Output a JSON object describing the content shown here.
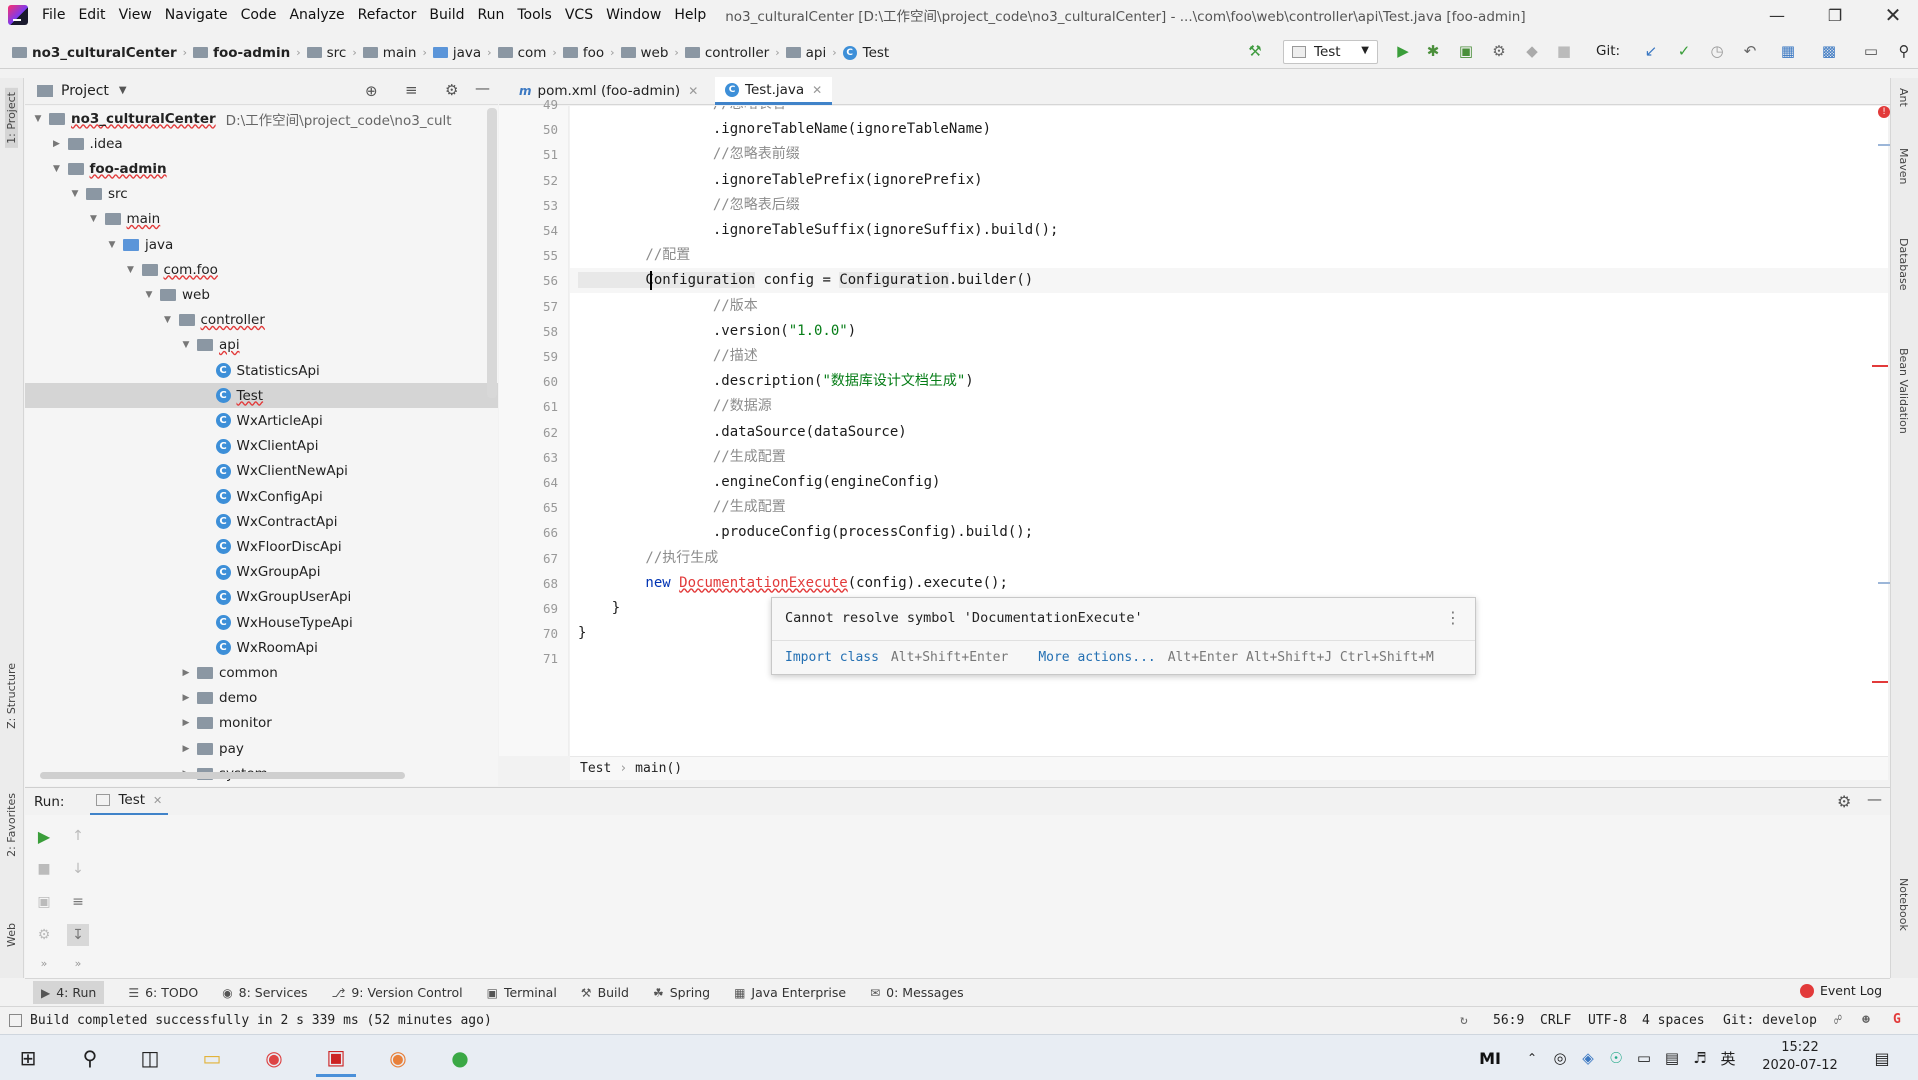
{
  "menu": {
    "items": [
      "File",
      "Edit",
      "View",
      "Navigate",
      "Code",
      "Analyze",
      "Refactor",
      "Build",
      "Run",
      "Tools",
      "VCS",
      "Window",
      "Help"
    ],
    "window_title": "no3_culturalCenter [D:\\工作空间\\project_code\\no3_culturalCenter] - ...\\com\\foo\\web\\controller\\api\\Test.java [foo-admin]"
  },
  "navbar": {
    "crumbs": [
      "no3_culturalCenter",
      "foo-admin",
      "src",
      "main",
      "java",
      "com",
      "foo",
      "web",
      "controller",
      "api",
      "Test"
    ],
    "run_config": "Test",
    "git_label": "Git:"
  },
  "project_panel": {
    "title": "Project",
    "tree": [
      {
        "label": "no3_culturalCenter",
        "path": "D:\\工作空间\\project_code\\no3_cult",
        "depth": 0,
        "type": "module",
        "open": true
      },
      {
        "label": ".idea",
        "depth": 1,
        "type": "folder",
        "open": false
      },
      {
        "label": "foo-admin",
        "depth": 1,
        "type": "module",
        "open": true
      },
      {
        "label": "src",
        "depth": 2,
        "type": "folder",
        "open": true
      },
      {
        "label": "main",
        "depth": 3,
        "type": "folder",
        "open": true
      },
      {
        "label": "java",
        "depth": 4,
        "type": "src",
        "open": true
      },
      {
        "label": "com.foo",
        "depth": 5,
        "type": "folder",
        "open": true
      },
      {
        "label": "web",
        "depth": 6,
        "type": "folder",
        "open": true
      },
      {
        "label": "controller",
        "depth": 7,
        "type": "folder",
        "open": true
      },
      {
        "label": "api",
        "depth": 8,
        "type": "folder",
        "open": true
      },
      {
        "label": "StatisticsApi",
        "depth": 9,
        "type": "class"
      },
      {
        "label": "Test",
        "depth": 9,
        "type": "class",
        "selected": true
      },
      {
        "label": "WxArticleApi",
        "depth": 9,
        "type": "class"
      },
      {
        "label": "WxClientApi",
        "depth": 9,
        "type": "class"
      },
      {
        "label": "WxClientNewApi",
        "depth": 9,
        "type": "class"
      },
      {
        "label": "WxConfigApi",
        "depth": 9,
        "type": "class"
      },
      {
        "label": "WxContractApi",
        "depth": 9,
        "type": "class"
      },
      {
        "label": "WxFloorDiscApi",
        "depth": 9,
        "type": "class"
      },
      {
        "label": "WxGroupApi",
        "depth": 9,
        "type": "class"
      },
      {
        "label": "WxGroupUserApi",
        "depth": 9,
        "type": "class"
      },
      {
        "label": "WxHouseTypeApi",
        "depth": 9,
        "type": "class"
      },
      {
        "label": "WxRoomApi",
        "depth": 9,
        "type": "class"
      },
      {
        "label": "common",
        "depth": 8,
        "type": "folder",
        "open": false
      },
      {
        "label": "demo",
        "depth": 8,
        "type": "folder",
        "open": false
      },
      {
        "label": "monitor",
        "depth": 8,
        "type": "folder",
        "open": false
      },
      {
        "label": "pay",
        "depth": 8,
        "type": "folder",
        "open": false
      },
      {
        "label": "system",
        "depth": 8,
        "type": "folder",
        "open": false
      }
    ]
  },
  "editor": {
    "tabs": [
      {
        "label": "pom.xml (foo-admin)",
        "active": false
      },
      {
        "label": "Test.java",
        "active": true
      }
    ],
    "lines": [
      {
        "n": "49",
        "tokens": [
          [
            "cmt",
            "                //忽略表名"
          ]
        ]
      },
      {
        "n": "50",
        "tokens": [
          [
            "ident",
            "                .ignoreTableName(ignoreTableName)"
          ]
        ]
      },
      {
        "n": "51",
        "tokens": [
          [
            "cmt",
            "                //忽略表前缀"
          ]
        ]
      },
      {
        "n": "52",
        "tokens": [
          [
            "ident",
            "                .ignoreTablePrefix(ignorePrefix)"
          ]
        ]
      },
      {
        "n": "53",
        "tokens": [
          [
            "cmt",
            "                //忽略表后缀"
          ]
        ]
      },
      {
        "n": "54",
        "tokens": [
          [
            "ident",
            "                .ignoreTableSuffix(ignoreSuffix).build();"
          ]
        ]
      },
      {
        "n": "55",
        "tokens": [
          [
            "cmt",
            "        //配置"
          ]
        ]
      },
      {
        "n": "56",
        "tokens": [
          [
            "typ",
            "        Configuration"
          ],
          [
            "ident",
            " config = "
          ],
          [
            "typ",
            "Configuration"
          ],
          [
            "ident",
            ".builder()"
          ]
        ],
        "caret": true
      },
      {
        "n": "57",
        "tokens": [
          [
            "cmt",
            "                //版本"
          ]
        ]
      },
      {
        "n": "58",
        "tokens": [
          [
            "ident",
            "                .version("
          ],
          [
            "str",
            "\"1.0.0\""
          ],
          [
            "ident",
            ")"
          ]
        ]
      },
      {
        "n": "59",
        "tokens": [
          [
            "cmt",
            "                //描述"
          ]
        ]
      },
      {
        "n": "60",
        "tokens": [
          [
            "ident",
            "                .description("
          ],
          [
            "str",
            "\"数据库设计文档生成\""
          ],
          [
            "ident",
            ")"
          ]
        ]
      },
      {
        "n": "61",
        "tokens": [
          [
            "cmt",
            "                //数据源"
          ]
        ]
      },
      {
        "n": "62",
        "tokens": [
          [
            "ident",
            "                .dataSource(dataSource)"
          ]
        ]
      },
      {
        "n": "63",
        "tokens": [
          [
            "cmt",
            "                //生成配置"
          ]
        ]
      },
      {
        "n": "64",
        "tokens": [
          [
            "ident",
            "                .engineConfig(engineConfig)"
          ]
        ]
      },
      {
        "n": "65",
        "tokens": [
          [
            "cmt",
            "                //生成配置"
          ]
        ]
      },
      {
        "n": "66",
        "tokens": [
          [
            "ident",
            "                .produceConfig(processConfig).build();"
          ]
        ]
      },
      {
        "n": "67",
        "tokens": [
          [
            "cmt",
            "        //执行生成"
          ]
        ]
      },
      {
        "n": "68",
        "tokens": [
          [
            "kw",
            "        new "
          ],
          [
            "err",
            "DocumentationExecute"
          ],
          [
            "ident",
            "(config).execute();"
          ]
        ]
      },
      {
        "n": "69",
        "tokens": [
          [
            "ident",
            "    }"
          ]
        ]
      },
      {
        "n": "70",
        "tokens": [
          [
            "ident",
            "}"
          ]
        ]
      },
      {
        "n": "71",
        "tokens": [
          [
            "ident",
            ""
          ]
        ]
      }
    ],
    "breadcrumb": [
      "Test",
      "main()"
    ]
  },
  "popup": {
    "message": "Cannot resolve symbol 'DocumentationExecute'",
    "action1": "Import class",
    "action1_keys": "Alt+Shift+Enter",
    "action2": "More actions...",
    "action2_keys": "Alt+Enter Alt+Shift+J Ctrl+Shift+M"
  },
  "run_panel": {
    "label": "Run:",
    "tab": "Test"
  },
  "tool_tabs": [
    {
      "label": "4: Run",
      "icon": "run-icon"
    },
    {
      "label": "6: TODO",
      "icon": "todo-icon"
    },
    {
      "label": "8: Services",
      "icon": "services-icon"
    },
    {
      "label": "9: Version Control",
      "icon": "vcs-icon"
    },
    {
      "label": "Terminal",
      "icon": "terminal-icon"
    },
    {
      "label": "Build",
      "icon": "build-icon"
    },
    {
      "label": "Spring",
      "icon": "spring-icon"
    },
    {
      "label": "Java Enterprise",
      "icon": "javaee-icon"
    },
    {
      "label": "0: Messages",
      "icon": "messages-icon"
    }
  ],
  "event_log": "Event Log",
  "status": {
    "message": "Build completed successfully in 2 s 339 ms (52 minutes ago)",
    "position": "56:9",
    "line_sep": "CRLF",
    "encoding": "UTF-8",
    "indent": "4 spaces",
    "git": "Git: develop"
  },
  "side_labels": {
    "project": "1: Project",
    "structure": "Z: Structure",
    "favorites": "2: Favorites",
    "web": "Web",
    "ant": "Ant",
    "maven": "Maven",
    "database": "Database",
    "bean_validation": "Bean Validation",
    "notebook": "Notebook"
  },
  "taskbar": {
    "time": "15:22",
    "date": "2020-07-12",
    "ime": "英"
  },
  "colors": {
    "accent": "#4083c9",
    "error": "#e23a3a",
    "string": "#067d17",
    "keyword": "#0033b3",
    "comment": "#8c8c8c"
  }
}
